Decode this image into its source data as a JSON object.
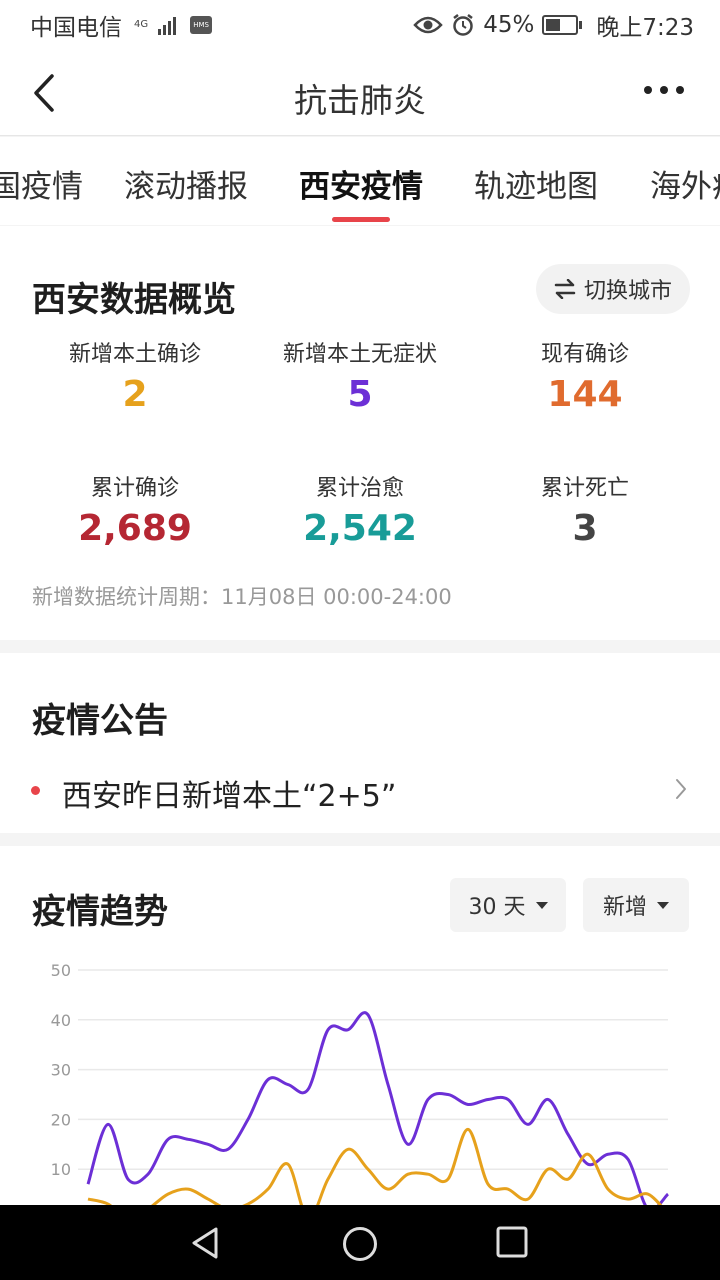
{
  "status_bar": {
    "carrier": "中国电信",
    "network": "4G",
    "hms": "HMS",
    "battery": "45%",
    "time": "晚上7:23"
  },
  "nav": {
    "title": "抗击肺炎"
  },
  "tabs": [
    {
      "label": "国疫情"
    },
    {
      "label": "滚动播报"
    },
    {
      "label": "西安疫情"
    },
    {
      "label": "轨迹地图"
    },
    {
      "label": "海外疫"
    }
  ],
  "overview": {
    "title": "西安数据概览",
    "switch_label": "切换城市",
    "stats": [
      {
        "label": "新增本土确诊",
        "value": "2",
        "color": "#e6a11c"
      },
      {
        "label": "新增本土无症状",
        "value": "5",
        "color": "#6c2fd6"
      },
      {
        "label": "现有确诊",
        "value": "144",
        "color": "#e06b2e"
      },
      {
        "label": "累计确诊",
        "value": "2,689",
        "color": "#b52733"
      },
      {
        "label": "累计治愈",
        "value": "2,542",
        "color": "#189c98"
      },
      {
        "label": "累计死亡",
        "value": "3",
        "color": "#444444"
      }
    ],
    "period": "新增数据统计周期：11月08日 00:00-24:00"
  },
  "notice": {
    "title": "疫情公告",
    "item": "西安昨日新增本土“2+5”"
  },
  "trend": {
    "title": "疫情趋势",
    "range_label": "30 天",
    "mode_label": "新增"
  },
  "chart_data": {
    "type": "line",
    "title": "",
    "xlabel": "",
    "ylabel": "",
    "ylim": [
      0,
      50
    ],
    "y_ticks": [
      "50",
      "40",
      "30",
      "20",
      "10"
    ],
    "grid": true,
    "x": [
      1,
      2,
      3,
      4,
      5,
      6,
      7,
      8,
      9,
      10,
      11,
      12,
      13,
      14,
      15,
      16,
      17,
      18,
      19,
      20,
      21,
      22,
      23,
      24,
      25,
      26,
      27,
      28,
      29,
      30
    ],
    "series": [
      {
        "color": "#6c2fd6",
        "values": [
          7,
          19,
          8,
          9,
          16,
          16,
          15,
          14,
          20,
          28,
          27,
          26,
          38,
          38,
          41,
          27,
          15,
          24,
          25,
          23,
          24,
          24,
          19,
          24,
          17,
          11,
          13,
          12,
          2,
          5
        ]
      },
      {
        "color": "#e6a11c",
        "values": [
          4,
          3,
          0,
          2,
          5,
          6,
          4,
          2,
          3,
          6,
          11,
          0,
          8,
          14,
          10,
          6,
          9,
          9,
          8,
          18,
          7,
          6,
          4,
          10,
          8,
          13,
          6,
          4,
          5,
          1
        ]
      }
    ]
  }
}
